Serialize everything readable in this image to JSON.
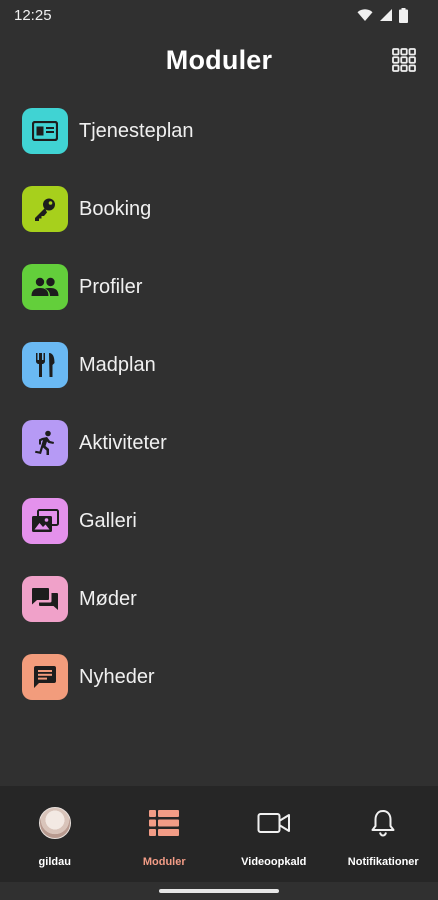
{
  "status": {
    "time": "12:25"
  },
  "header": {
    "title": "Moduler",
    "menu_icon": "grid-icon"
  },
  "modules": [
    {
      "label": "Tjenesteplan",
      "icon": "id-card-icon",
      "color": "#40d3d3"
    },
    {
      "label": "Booking",
      "icon": "key-icon",
      "color": "#a7d01c"
    },
    {
      "label": "Profiler",
      "icon": "people-icon",
      "color": "#63cf3b"
    },
    {
      "label": "Madplan",
      "icon": "cutlery-icon",
      "color": "#6ab9f3"
    },
    {
      "label": "Aktiviteter",
      "icon": "running-icon",
      "color": "#b69af5"
    },
    {
      "label": "Galleri",
      "icon": "photos-icon",
      "color": "#e491ec"
    },
    {
      "label": "Møder",
      "icon": "chat-bubbles-icon",
      "color": "#f0a1c9"
    },
    {
      "label": "Nyheder",
      "icon": "message-icon",
      "color": "#f29c7c"
    }
  ],
  "nav": {
    "items": [
      {
        "label": "gildau",
        "icon": "avatar"
      },
      {
        "label": "Moduler",
        "icon": "list-icon",
        "active": true
      },
      {
        "label": "Videoopkald",
        "icon": "video-camera-icon"
      },
      {
        "label": "Notifikationer",
        "icon": "bell-icon"
      }
    ],
    "active_color": "#f29c86"
  }
}
